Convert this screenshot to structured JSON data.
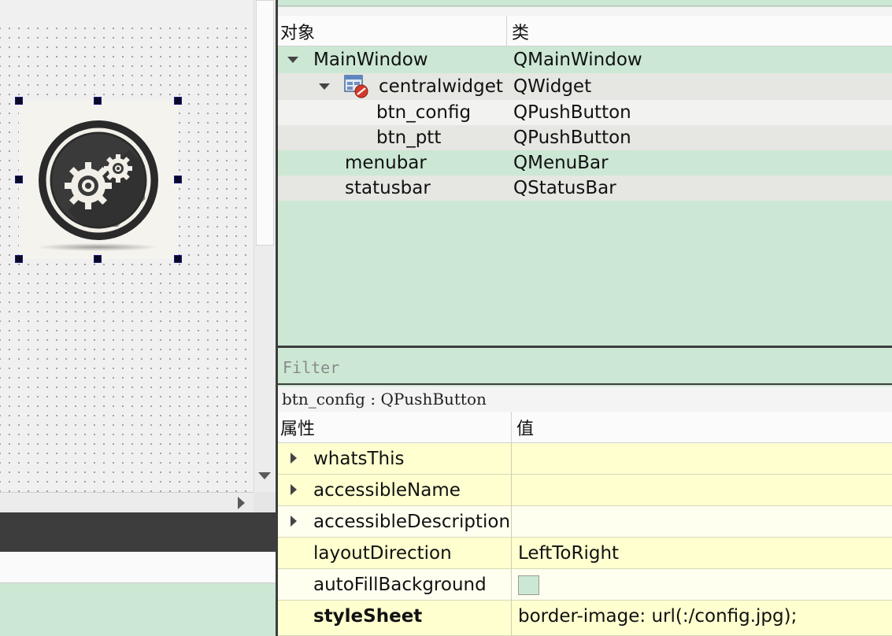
{
  "object_inspector": {
    "col_object": "对象",
    "col_class": "类",
    "rows": [
      {
        "name": "MainWindow",
        "class": "QMainWindow"
      },
      {
        "name": "centralwidget",
        "class": "QWidget"
      },
      {
        "name": "btn_config",
        "class": "QPushButton"
      },
      {
        "name": "btn_ptt",
        "class": "QPushButton"
      },
      {
        "name": "menubar",
        "class": "QMenuBar"
      },
      {
        "name": "statusbar",
        "class": "QStatusBar"
      }
    ]
  },
  "filter": {
    "placeholder": "Filter"
  },
  "property_editor": {
    "selected": "btn_config : QPushButton",
    "col_property": "属性",
    "col_value": "值",
    "rows": [
      {
        "name": "whatsThis",
        "value": ""
      },
      {
        "name": "accessibleName",
        "value": ""
      },
      {
        "name": "accessibleDescription",
        "value": ""
      },
      {
        "name": "layoutDirection",
        "value": "LeftToRight"
      },
      {
        "name": "autoFillBackground",
        "value": ""
      },
      {
        "name": "styleSheet",
        "value": "border-image: url(:/config.jpg);"
      }
    ]
  },
  "colors": {
    "accent_green": "#cce8d4",
    "property_yellow": "#ffffd0",
    "dark_border": "#3d3d3d",
    "selection_handle": "#0a0a26"
  },
  "icons": [
    "gear-icon",
    "widget-icon",
    "expand-arrow-icon",
    "collapse-arrow-icon"
  ]
}
